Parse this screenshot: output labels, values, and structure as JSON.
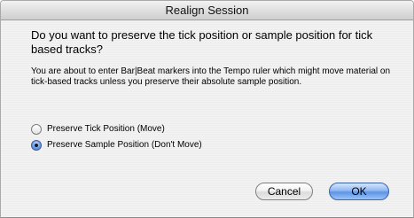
{
  "window": {
    "title": "Realign Session"
  },
  "dialog": {
    "heading": "Do you want to preserve the tick position or sample position for tick based tracks?",
    "body": "You are about to enter Bar|Beat markers into the Tempo ruler which might move material on tick-based tracks unless you preserve their absolute sample position.",
    "options": [
      {
        "label": "Preserve Tick Position (Move)",
        "selected": false
      },
      {
        "label": "Preserve Sample Position (Don't Move)",
        "selected": true
      }
    ]
  },
  "buttons": {
    "cancel_label": "Cancel",
    "ok_label": "OK"
  }
}
